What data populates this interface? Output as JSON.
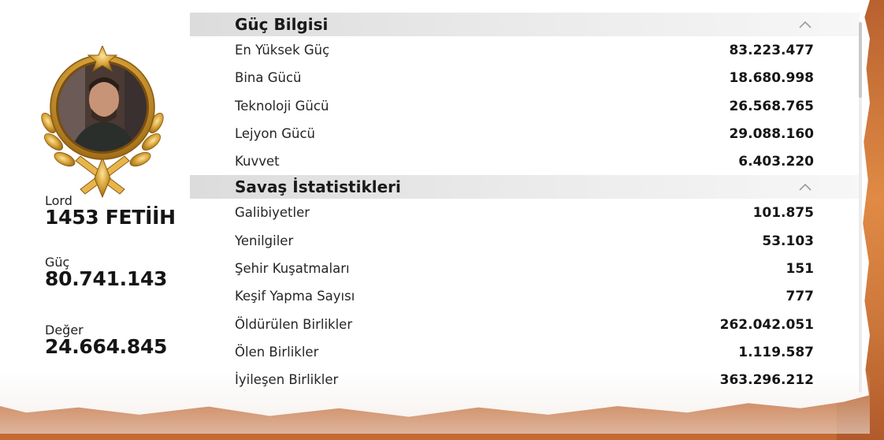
{
  "profile": {
    "avatar_icon": "gold-laurel-badge",
    "title_label": "Lord",
    "name": "1453 FETİİH",
    "power_label": "Güç",
    "power_value": "80.741.143",
    "value_label": "Değer",
    "value_value": "24.664.845"
  },
  "sections": [
    {
      "title": "Güç Bilgisi",
      "collapse_icon": "chevron-up-icon",
      "rows": [
        {
          "label": "En Yüksek Güç",
          "value": "83.223.477"
        },
        {
          "label": "Bina Gücü",
          "value": "18.680.998"
        },
        {
          "label": "Teknoloji Gücü",
          "value": "26.568.765"
        },
        {
          "label": "Lejyon Gücü",
          "value": "29.088.160"
        },
        {
          "label": "Kuvvet",
          "value": "6.403.220"
        }
      ]
    },
    {
      "title": "Savaş İstatistikleri",
      "collapse_icon": "chevron-up-icon",
      "rows": [
        {
          "label": "Galibiyetler",
          "value": "101.875"
        },
        {
          "label": "Yenilgiler",
          "value": "53.103"
        },
        {
          "label": "Şehir Kuşatmaları",
          "value": "151"
        },
        {
          "label": "Keşif Yapma Sayısı",
          "value": "777"
        },
        {
          "label": "Öldürülen Birlikler",
          "value": "262.042.051"
        },
        {
          "label": "Ölen Birlikler",
          "value": "1.119.587"
        },
        {
          "label": "İyileşen Birlikler",
          "value": "363.296.212"
        }
      ]
    }
  ],
  "colors": {
    "backdrop": "#c46a34",
    "gold": "#d9a53b",
    "header_gray": "#e2e2e2"
  }
}
